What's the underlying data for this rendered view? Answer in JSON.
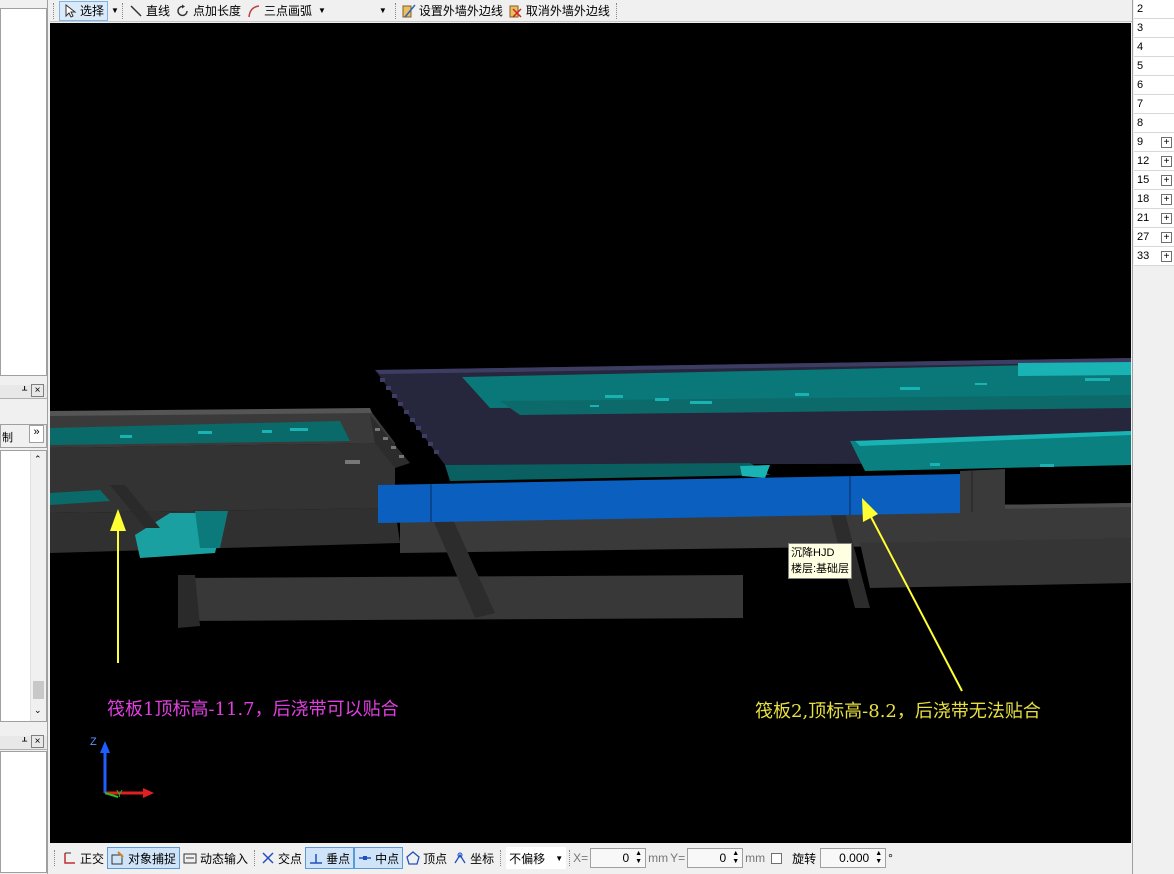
{
  "toolbar": {
    "select_label": "选择",
    "line_label": "直线",
    "point_length_label": "点加长度",
    "arc_label": "三点画弧",
    "set_outer_wall_label": "设置外墙外边线",
    "cancel_outer_wall_label": "取消外墙外边线"
  },
  "left_panel": {
    "tab_text": "制",
    "more": "»"
  },
  "floors": [
    "2",
    "3",
    "4",
    "5",
    "6",
    "7",
    "8",
    "9",
    "12",
    "15",
    "18",
    "21",
    "27",
    "33"
  ],
  "floor_expand": "+",
  "viewport": {
    "tooltip_line1": "沉降HJD",
    "tooltip_line2": "楼层:基础层",
    "annotation_left": "筏板1顶标高-11.7，后浇带可以贴合",
    "annotation_right": "筏板2,顶标高-8.2，后浇带无法贴合",
    "axis_z": "Z",
    "axis_y": "Y",
    "colors": {
      "background": "#000000",
      "slab": "#26263c",
      "teal": "#0a8080",
      "cyan": "#1ab3b3",
      "beam": "#3a3a3a",
      "post_pour_band": "#0a5fbf",
      "arrow": "#ffff33"
    }
  },
  "statusbar": {
    "ortho": "正交",
    "snap": "对象捕捉",
    "dynamic_input": "动态输入",
    "intersection": "交点",
    "perpendicular": "垂点",
    "midpoint": "中点",
    "vertex": "顶点",
    "coordinate": "坐标",
    "offset_mode": "不偏移",
    "x_label": "X=",
    "x_value": "0",
    "unit1": "mm",
    "y_label": "Y=",
    "y_value": "0",
    "unit2": "mm",
    "rotate_label": "旋转",
    "rotate_value": "0.000",
    "degree": "°"
  }
}
